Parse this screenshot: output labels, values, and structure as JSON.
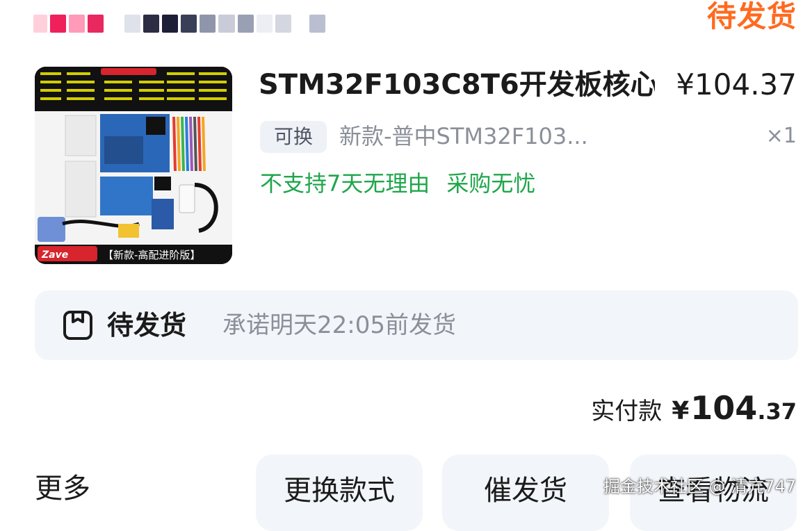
{
  "header": {
    "status": "待发货",
    "status_color": "#ff6a1f"
  },
  "product": {
    "image_name": "stm32-dev-board-kit-photo",
    "image_caption": "【新款-高配进阶版】",
    "title": "STM32F103C8T6开发板核心",
    "price": "¥104.37",
    "swap_tag": "可换",
    "variant": "新款-普中STM32F103...",
    "quantity": "×1",
    "no_return_tag": "不支持7天无理由",
    "worry_free_tag": "采购无忧",
    "tag_color": "#1fa64b"
  },
  "shipping": {
    "icon": "package-box-icon",
    "status": "待发货",
    "promise": "承诺明天22:05前发货"
  },
  "payment": {
    "label": "实付款",
    "currency": "¥",
    "amount_int": "104",
    "amount_dec": ".37"
  },
  "actions": {
    "more": "更多",
    "change_style": "更换款式",
    "urge_shipping": "催发货",
    "view_logistics": "查看物流"
  },
  "watermark": "掘金技术社区 @ 清亢747"
}
